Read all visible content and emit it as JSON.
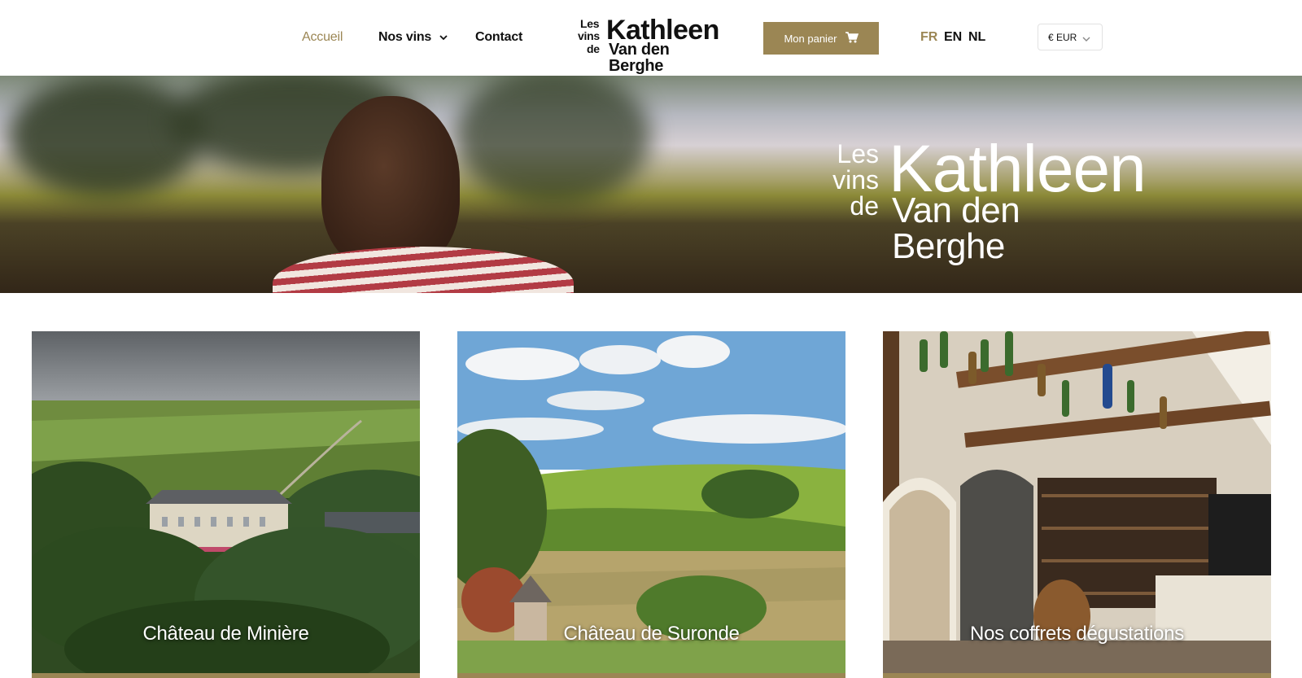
{
  "nav": {
    "items": [
      {
        "label": "Accueil",
        "active": true
      },
      {
        "label": "Nos vins",
        "has_dropdown": true
      },
      {
        "label": "Contact"
      }
    ]
  },
  "logo": {
    "line1": "Les",
    "line2": "vins",
    "line3": "de",
    "name1": "Kathleen",
    "name2": "Van den Berghe"
  },
  "cart": {
    "label": "Mon panier",
    "icon": "cart-icon"
  },
  "languages": [
    {
      "code": "FR",
      "active": true
    },
    {
      "code": "EN"
    },
    {
      "code": "NL"
    }
  ],
  "currency": {
    "value": "€ EUR"
  },
  "hero": {
    "logo": {
      "line1": "Les",
      "line2": "vins",
      "line3": "de",
      "name1": "Kathleen",
      "name2": "Van den Berghe"
    }
  },
  "cards": [
    {
      "title": "Château de Minière"
    },
    {
      "title": "Château de Suronde"
    },
    {
      "title": "Nos coffrets dégustations"
    }
  ],
  "colors": {
    "accent": "#9b8654",
    "text": "#111111",
    "background": "#ffffff"
  }
}
